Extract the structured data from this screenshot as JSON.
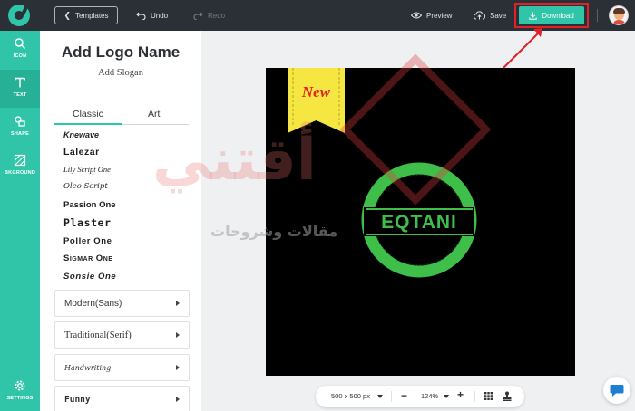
{
  "topbar": {
    "templates": "Templates",
    "undo": "Undo",
    "redo": "Redo",
    "preview": "Preview",
    "save": "Save",
    "download": "Download"
  },
  "rail": {
    "icon": "ICON",
    "text": "TEXT",
    "shape": "SHAPE",
    "background": "BKGROUND",
    "settings": "SETTINGS"
  },
  "panel": {
    "title": "Add Logo Name",
    "slogan": "Add Slogan",
    "tabs": [
      "Classic",
      "Art"
    ],
    "fonts": [
      "Knewave",
      "Lalezar",
      "Lily Script One",
      "Oleo Script",
      "Passion One",
      "Plaster",
      "Poller One",
      "Sigmar One",
      "Sonsie One"
    ],
    "categories": [
      "Modern(Sans)",
      "Traditional(Serif)",
      "Handwriting",
      "Funny"
    ]
  },
  "logo": {
    "ribbon_text": "New",
    "name": "EQTANI",
    "ribbon_color": "#f5e642",
    "ring_color": "#3fbf4a",
    "background": "#000000"
  },
  "watermark": {
    "letters": "أقتني",
    "tagline": "مقالات وشروحات"
  },
  "zoombar": {
    "size": "500 x 500 px",
    "zoom": "124%",
    "minus": "−",
    "plus": "+"
  },
  "colors": {
    "accent": "#30c4a8",
    "topbar": "#2b2f36",
    "highlight": "#e0212a"
  }
}
